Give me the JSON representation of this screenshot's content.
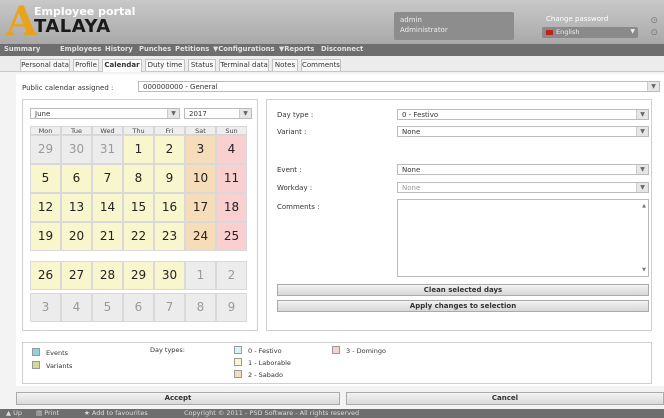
{
  "header": {
    "logo_letter": "A",
    "app_title": "Employee portal",
    "brand": "TALAYA",
    "user_name": "admin",
    "user_role": "Administrator",
    "change_password": "Change password",
    "language": "English"
  },
  "menu": [
    "Summary",
    "Employees",
    "History",
    "Punches",
    "Petitions",
    "▼Configurations",
    "▼Reports",
    "Disconnect"
  ],
  "tabs": [
    "Personal data",
    "Profile",
    "Calendar",
    "Duty time",
    "Status",
    "Terminal data",
    "Notes",
    "Comments"
  ],
  "calendar_assign": {
    "label": "Public calendar assigned :",
    "value": "000000000 - General"
  },
  "calendar": {
    "month": "June",
    "year": "2017",
    "weekdays": [
      "Mon",
      "Tue",
      "Wed",
      "Thu",
      "Fri",
      "Sat",
      "Sun"
    ],
    "weeks": [
      [
        "29",
        "30",
        "31",
        "1",
        "2",
        "3",
        "4"
      ],
      [
        "5",
        "6",
        "7",
        "8",
        "9",
        "10",
        "11"
      ],
      [
        "12",
        "13",
        "14",
        "15",
        "16",
        "17",
        "18"
      ],
      [
        "19",
        "20",
        "21",
        "22",
        "23",
        "24",
        "25"
      ],
      [
        "26",
        "27",
        "28",
        "29",
        "30",
        "1",
        "2"
      ],
      [
        "3",
        "4",
        "5",
        "6",
        "7",
        "8",
        "9"
      ]
    ]
  },
  "details": {
    "day_type_label": "Day type :",
    "day_type_value": "0 - Festivo",
    "variant_label": "Variant :",
    "variant_value": "None",
    "event_label": "Event :",
    "event_value": "None",
    "workday_label": "Workday :",
    "workday_value": "None",
    "comments_label": "Comments :",
    "clean_button": "Clean selected days",
    "apply_button": "Apply changes to selection"
  },
  "legend": {
    "events": "Events",
    "variants": "Variants",
    "day_types_label": "Day types:",
    "types": [
      "0 - Festivo",
      "1 - Laborable",
      "2 - Sabado",
      "3 - Domingo"
    ],
    "colors": {
      "events": "#8fd0dc",
      "variants": "#d6dc8f",
      "festivo": "#d8f1f6",
      "laborable": "#f8f6cc",
      "sabado": "#f6dcb9",
      "domingo": "#f9cfcf"
    }
  },
  "buttons": {
    "accept": "Accept",
    "cancel": "Cancel"
  },
  "footer": {
    "up": "Up",
    "print": "Print",
    "favourites": "Add to favourites",
    "copyright": "Copyright © 2011 - PSD Software - All rights reserved"
  }
}
